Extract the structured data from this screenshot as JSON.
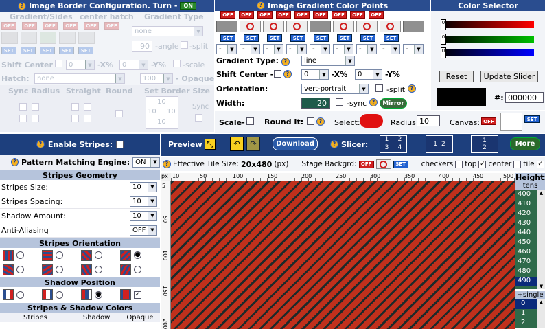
{
  "border_panel": {
    "title": "Image Border Configuration. Turn -",
    "toggle": "ON",
    "col_gradient_sides": "Gradient/Sides",
    "col_center_hatch": "center hatch",
    "col_gradient_type": "Gradient Type",
    "gradient_type_value": "none",
    "angle_value": "90",
    "angle_label": "-angle",
    "split_label": "-split",
    "shift_center_label": "Shift Center -",
    "x_label": "-X%",
    "y_label": "-Y%",
    "x_value": "0",
    "y_value": "0",
    "scale_label": "-scale",
    "hatch_label": "Hatch:",
    "hatch_value": "none",
    "opaque_value": "100",
    "opaque_label": "- Opaque",
    "sync_radius": "Sync Radius",
    "straight": "Straight",
    "round": "Round",
    "set_border_size": "Set Border Size",
    "size_top": "10",
    "size_left": "10",
    "size_right": "10",
    "size_bottom": "10",
    "sync": "Sync"
  },
  "gradient_panel": {
    "title": "Image Gradient Color Points",
    "off": "OFF",
    "set": "SET",
    "dash": "-",
    "gradient_type_label": "Gradient Type:",
    "gradient_type_value": "line",
    "shift_center_label": "Shift Center -",
    "x_value": "0",
    "x_label": "-X%",
    "y_value": "0",
    "y_label": "-Y%",
    "orientation_label": "Orientation:",
    "orientation_value": "vert-portrait",
    "split_label": "-split",
    "width_label": "Width:",
    "width_value": "20",
    "sync_label": "-sync",
    "mirror": "Mirror"
  },
  "color_selector": {
    "title": "Color Selector",
    "slider_r": "0",
    "slider_g": "0",
    "slider_b": "0",
    "reset": "Reset",
    "update": "Update Slider",
    "hash": "#:",
    "hex": "000000",
    "colors": {
      "red": "#ff0000",
      "green": "#00c000",
      "blue": "#0000ff"
    }
  },
  "toprow": {
    "scale": "Scale-",
    "round_it": "Round It:",
    "select": "Select:",
    "radius_label": "Radius:",
    "radius_value": "10",
    "canvas": "Canvas:",
    "off": "OFF",
    "set": "SET"
  },
  "stripes": {
    "enable": "Enable Stripes:",
    "engine_label": "Pattern Matching Engine:",
    "engine_value": "ON",
    "geometry": "Stripes Geometry",
    "size_label": "Stripes Size:",
    "size_value": "10",
    "spacing_label": "Stripes Spacing:",
    "spacing_value": "10",
    "shadow_label": "Shadow Amount:",
    "shadow_value": "10",
    "aa_label": "Anti-Aliasing",
    "aa_value": "OFF",
    "orientation": "Stripes Orientation",
    "shadow_position": "Shadow Position",
    "colors": "Stripes & Shadow Colors",
    "col_stripes": "Stripes",
    "col_shadow": "Shadow",
    "col_opaque": "Opaque"
  },
  "preview": {
    "preview": "Preview",
    "download": "Download",
    "slicer": "Slicer:",
    "slice1": [
      "1",
      "2",
      "3",
      "4"
    ],
    "slice2": [
      "1",
      "2"
    ],
    "slice3": [
      "1",
      "2"
    ],
    "more": "More",
    "tile_size_label": "Effective Tile Size:",
    "tile_size": "20x480",
    "tile_unit": "(px)",
    "stage_bg": "Stage Backgrd:",
    "off": "OFF",
    "set": "SET",
    "checkers": "checkers",
    "top": "top",
    "center": "center",
    "tile": "tile",
    "px": "px",
    "ruler_x": [
      "10",
      "50",
      "100",
      "150",
      "200",
      "250",
      "300",
      "350",
      "400",
      "450",
      "500"
    ],
    "ruler_y": [
      "5",
      "50",
      "100",
      "150",
      "200"
    ]
  },
  "height_panel": {
    "title": "Height:",
    "unit": "tens",
    "values": [
      "400",
      "410",
      "420",
      "430",
      "440",
      "450",
      "460",
      "470",
      "480",
      "490"
    ],
    "selected": "490",
    "single": "+single",
    "single_values": [
      "0",
      "1",
      "2"
    ],
    "single_selected": "0"
  },
  "stripe_colors": {
    "red": "#c0301c",
    "dark": "#1c2a2a"
  }
}
